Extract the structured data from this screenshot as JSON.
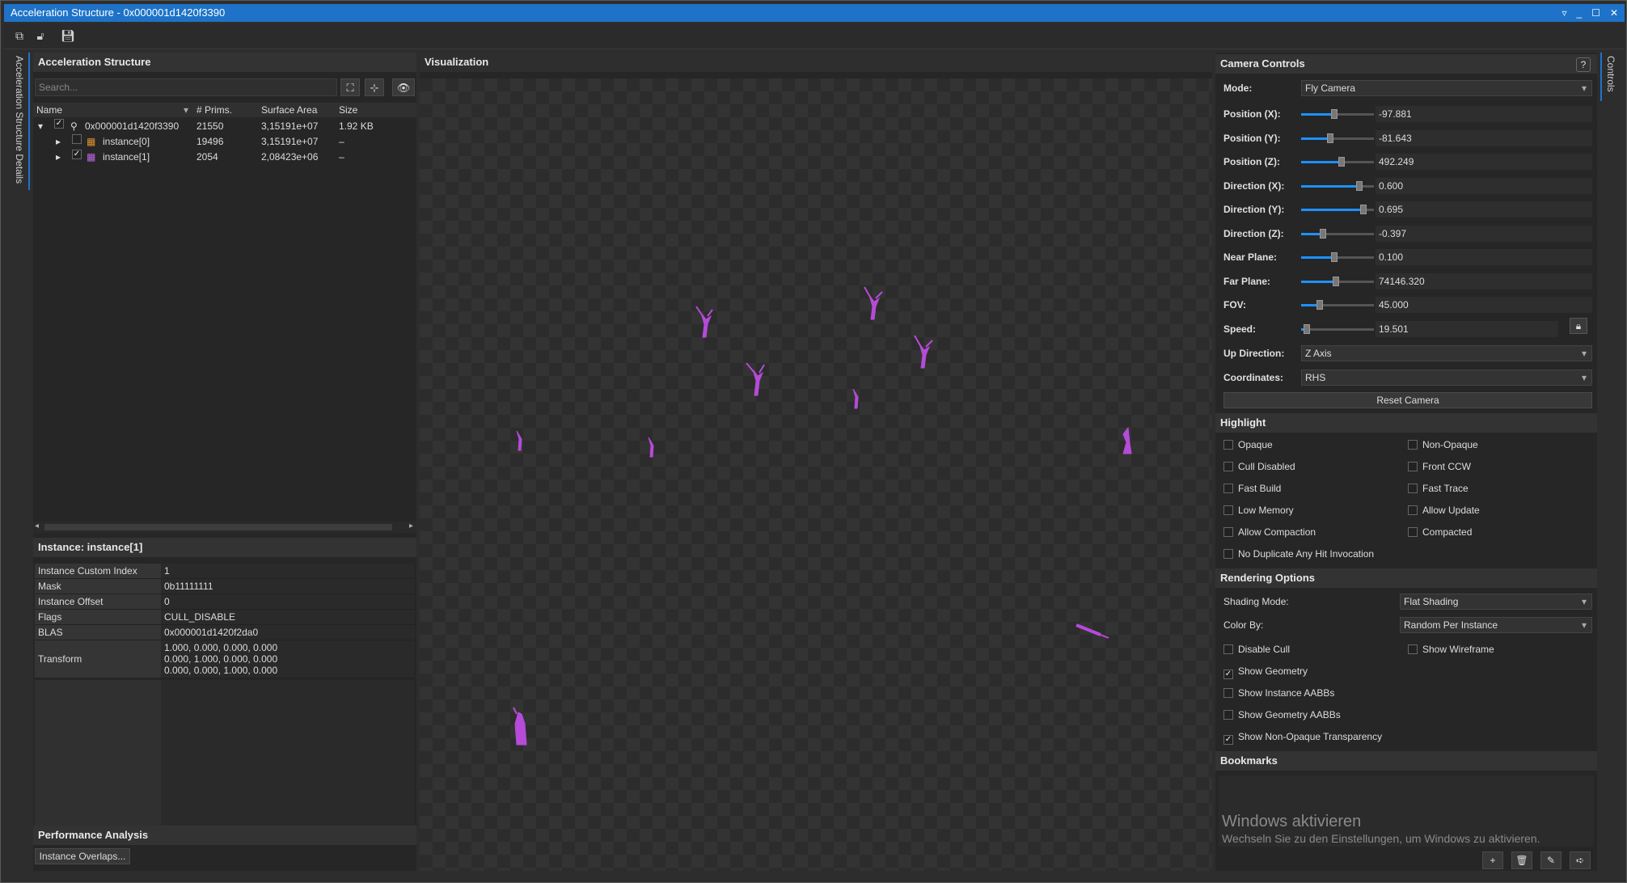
{
  "window": {
    "title": "Acceleration Structure - 0x000001d1420f3390"
  },
  "sidetabs": {
    "left": "Acceleration Structure Details",
    "right": "Controls"
  },
  "left": {
    "header": "Acceleration Structure",
    "search_placeholder": "Search...",
    "columns": [
      "Name",
      "# Prims.",
      "Surface Area",
      "Size"
    ],
    "rows": [
      {
        "name": "0x000001d1420f3390",
        "prims": "21550",
        "area": "3,15191e+07",
        "size": "1.92 KB",
        "checked": "✓"
      },
      {
        "name": "instance[0]",
        "prims": "19496",
        "area": "3,15191e+07",
        "size": "–",
        "checked": ""
      },
      {
        "name": "instance[1]",
        "prims": "2054",
        "area": "2,08423e+06",
        "size": "–",
        "checked": "✓"
      }
    ],
    "instance_header": "Instance: instance[1]",
    "props": [
      {
        "k": "Instance Custom Index",
        "v": "1"
      },
      {
        "k": "Mask",
        "v": "0b11111111"
      },
      {
        "k": "Instance Offset",
        "v": "0"
      },
      {
        "k": "Flags",
        "v": "CULL_DISABLE"
      },
      {
        "k": "BLAS",
        "v": "0x000001d1420f2da0"
      }
    ],
    "transform": {
      "k": "Transform",
      "rows": [
        "1.000, 0.000, 0.000, 0.000",
        "0.000, 1.000, 0.000, 0.000",
        "0.000, 0.000, 1.000, 0.000"
      ]
    },
    "perf_header": "Performance Analysis",
    "perf_button": "Instance Overlaps..."
  },
  "viz": {
    "header": "Visualization",
    "accent": "#b54bd8"
  },
  "camera": {
    "header": "Camera Controls",
    "mode_label": "Mode:",
    "mode_value": "Fly Camera",
    "fields": [
      {
        "label": "Position (X):",
        "value": "-97.881",
        "level": 0.45
      },
      {
        "label": "Position (Y):",
        "value": "-81.643",
        "level": 0.4
      },
      {
        "label": "Position (Z):",
        "value": "492.249",
        "level": 0.55
      },
      {
        "label": "Direction (X):",
        "value": "0.600",
        "level": 0.8
      },
      {
        "label": "Direction (Y):",
        "value": "0.695",
        "level": 0.85
      },
      {
        "label": "Direction (Z):",
        "value": "-0.397",
        "level": 0.3
      },
      {
        "label": "Near Plane:",
        "value": "0.100",
        "level": 0.45
      },
      {
        "label": "Far Plane:",
        "value": "74146.320",
        "level": 0.48
      },
      {
        "label": "FOV:",
        "value": "45.000",
        "level": 0.25
      },
      {
        "label": "Speed:",
        "value": "19.501",
        "level": 0.08
      }
    ],
    "up_label": "Up Direction:",
    "up_value": "Z Axis",
    "coord_label": "Coordinates:",
    "coord_value": "RHS",
    "reset": "Reset Camera"
  },
  "highlight": {
    "header": "Highlight",
    "items": [
      "Opaque",
      "Non-Opaque",
      "Cull Disabled",
      "Front CCW",
      "Fast Build",
      "Fast Trace",
      "Low Memory",
      "Allow Update",
      "Allow Compaction",
      "Compacted",
      "No Duplicate Any Hit Invocation"
    ]
  },
  "rendering": {
    "header": "Rendering Options",
    "shading_label": "Shading Mode:",
    "shading_value": "Flat Shading",
    "color_label": "Color By:",
    "color_value": "Random Per Instance",
    "disable_cull": "Disable Cull",
    "show_wireframe": "Show Wireframe",
    "show_geometry": "Show Geometry",
    "show_instance_aabbs": "Show Instance AABBs",
    "show_geometry_aabbs": "Show Geometry AABBs",
    "show_non_opaque": "Show Non-Opaque Transparency",
    "check": "✓"
  },
  "bookmarks": {
    "header": "Bookmarks",
    "wm_title": "Windows aktivieren",
    "wm_text": "Wechseln Sie zu den Einstellungen, um Windows zu aktivieren."
  }
}
